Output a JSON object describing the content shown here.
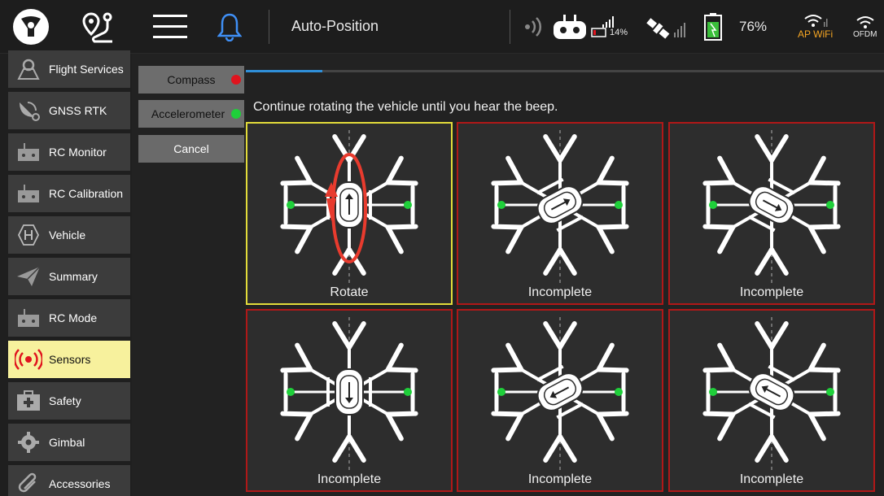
{
  "header": {
    "title": "Auto-Position",
    "rc_battery": "14%",
    "vehicle_battery": "76%",
    "wifi_label": "AP WiFi",
    "ofdm_label": "OFDM"
  },
  "sidebar": {
    "items": [
      {
        "label": "Flight Services",
        "icon": "map-pin-icon"
      },
      {
        "label": "GNSS RTK",
        "icon": "satellite-dish-icon"
      },
      {
        "label": "RC Monitor",
        "icon": "rc-controller-icon"
      },
      {
        "label": "RC Calibration",
        "icon": "rc-controller-icon"
      },
      {
        "label": "Vehicle",
        "icon": "hexagon-h-icon"
      },
      {
        "label": "Summary",
        "icon": "paper-plane-icon"
      },
      {
        "label": "RC Mode",
        "icon": "rc-controller-icon"
      },
      {
        "label": "Sensors",
        "icon": "radio-waves-icon",
        "active": true
      },
      {
        "label": "Safety",
        "icon": "first-aid-kit-icon"
      },
      {
        "label": "Gimbal",
        "icon": "gear-icon"
      },
      {
        "label": "Accessories",
        "icon": "paperclip-icon"
      }
    ]
  },
  "calibration": {
    "compass_label": "Compass",
    "compass_status_color": "#e0141e",
    "accelerometer_label": "Accelerometer",
    "accelerometer_status_color": "#1fcf3a",
    "cancel_label": "Cancel",
    "progress": 0.12,
    "instruction": "Continue rotating the vehicle until you hear the beep.",
    "tiles": [
      {
        "label": "Rotate",
        "state": "current"
      },
      {
        "label": "Incomplete",
        "state": "incomplete"
      },
      {
        "label": "Incomplete",
        "state": "incomplete"
      },
      {
        "label": "Incomplete",
        "state": "incomplete"
      },
      {
        "label": "Incomplete",
        "state": "incomplete"
      },
      {
        "label": "Incomplete",
        "state": "incomplete"
      }
    ]
  },
  "colors": {
    "accent_active": "#f7f19d",
    "tile_current_border": "#e3dc3a",
    "tile_incomplete_border": "#b01818",
    "progress": "#2f8fd8",
    "wifi": "#f6a623"
  }
}
